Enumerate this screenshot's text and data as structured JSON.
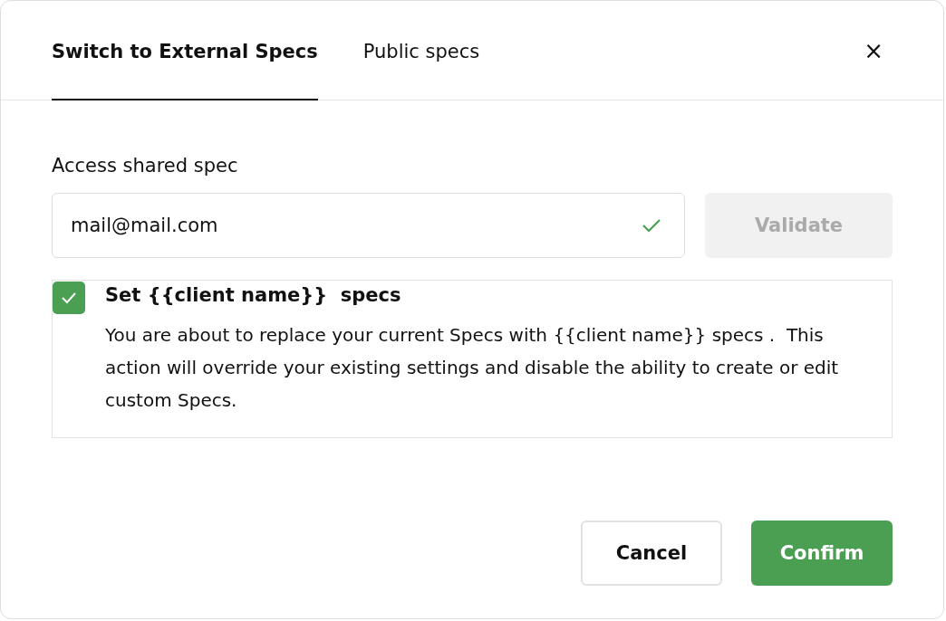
{
  "tabs": [
    {
      "label": "Switch to External Specs",
      "selected": true
    },
    {
      "label": "Public specs",
      "selected": false
    }
  ],
  "close": "×",
  "field": {
    "label": "Access shared spec",
    "value": "mail@mail.com",
    "valid": true
  },
  "validate": {
    "label": "Validate",
    "disabled": true
  },
  "option": {
    "checked": true,
    "title": "Set {{client name}}  specs",
    "text": "You are about to replace your current Specs with {{client name}} specs .  This action will override your existing settings and disable the ability to create or edit custom Specs."
  },
  "buttons": [
    {
      "label": "Cancel",
      "kind": "secondary"
    },
    {
      "label": "Confirm",
      "kind": "primary"
    }
  ]
}
